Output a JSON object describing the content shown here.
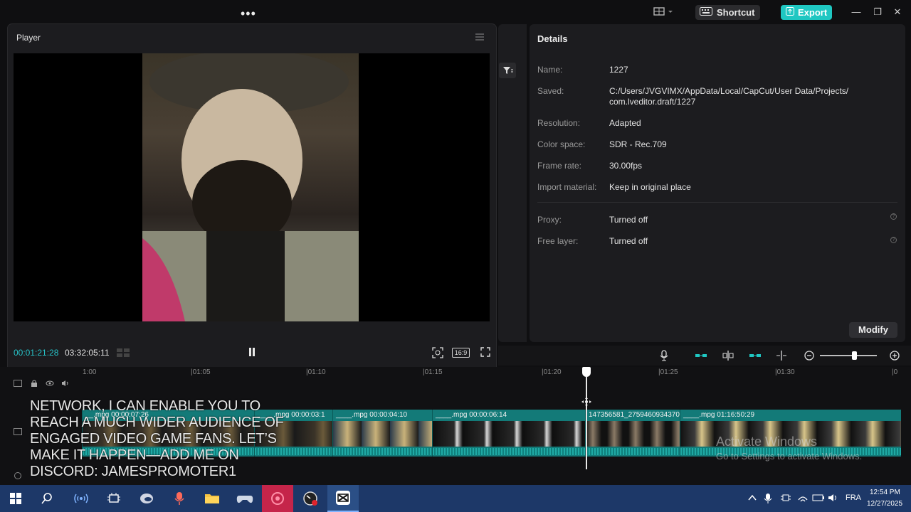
{
  "topbar": {
    "more_icon": "more-horizontal-icon",
    "shortcut_label": "Shortcut",
    "export_label": "Export"
  },
  "player": {
    "title": "Player",
    "current_time": "00:01:21:28",
    "total_time": "03:32:05:11",
    "ratio_label": "16:9"
  },
  "details": {
    "title": "Details",
    "rows": [
      {
        "label": "Name:",
        "value": "1227"
      },
      {
        "label": "Saved:",
        "value": "C:/Users/JVGVIMX/AppData/Local/CapCut/User Data/Projects/",
        "value2": "com.lveditor.draft/1227"
      },
      {
        "label": "Resolution:",
        "value": "Adapted"
      },
      {
        "label": "Color space:",
        "value": "SDR - Rec.709"
      },
      {
        "label": "Frame rate:",
        "value": "30.00fps"
      },
      {
        "label": "Import material:",
        "value": "Keep in original place"
      },
      {
        "label": "Proxy:",
        "value": "Turned off"
      },
      {
        "label": "Free layer:",
        "value": "Turned off"
      }
    ],
    "modify_label": "Modify"
  },
  "timeline": {
    "ruler_ticks": [
      "1:00",
      "|01:05",
      "|01:10",
      "|01:15",
      "|01:20",
      "|01:25",
      "|01:30",
      "|0"
    ],
    "clips": [
      {
        "label": "__.mpg  00:00:07:26"
      },
      {
        "label": "____.mpg  00:00:03:1"
      },
      {
        "label": "____.mpg  00:00:04:10"
      },
      {
        "label": "____.mpg  00:00:06:14"
      },
      {
        "label": "147356581_2759460934370"
      },
      {
        "label": "____.mpg  01:16:50:29"
      }
    ],
    "overlay_text": "NETWORK, I CAN ENABLE YOU TO REACH A MUCH WIDER AUDIENCE OF ENGAGED VIDEO GAME FANS. LET’S MAKE IT HAPPEN—ADD ME ON DISCORD: JAMESPROMOTER1"
  },
  "watermark": {
    "line1": "Activate Windows",
    "line2": "Go to Settings to activate Windows."
  },
  "taskbar": {
    "language": "FRA",
    "time": "12:54 PM",
    "date": "12/27/2025"
  },
  "colors": {
    "accent": "#1fc7c2",
    "timecode": "#27c3c8",
    "clip_track": "#137a78",
    "taskbar": "#1d3868"
  }
}
